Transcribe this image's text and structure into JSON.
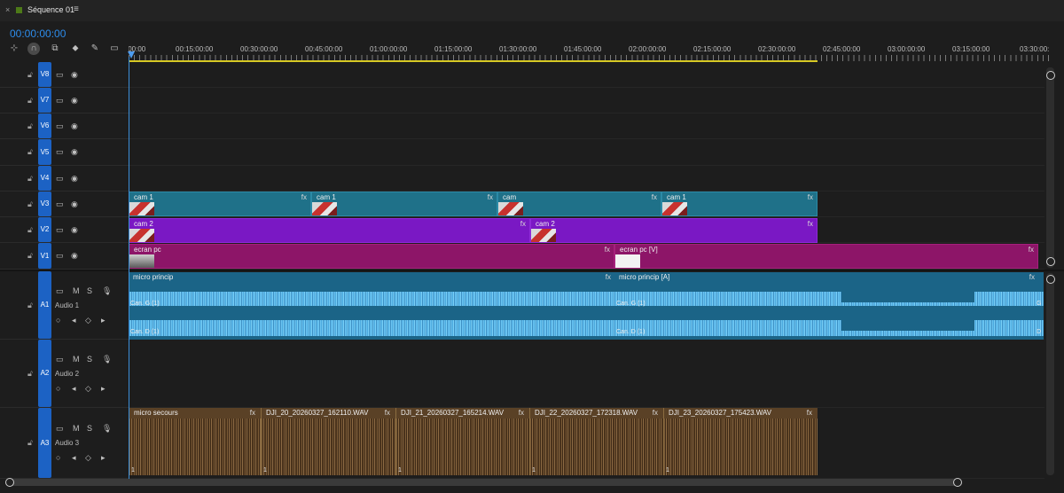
{
  "tab": {
    "close": "×",
    "title": "Séquence 01",
    "menu": "≡"
  },
  "timecode": "00:00:00:00",
  "tools": [
    "insert-snap-icon",
    "magnet-icon",
    "linked-selection-icon",
    "marker-icon",
    "wrench-icon",
    "captions-icon"
  ],
  "ruler": [
    ":00:00",
    "00:15:00:00",
    "00:30:00:00",
    "00:45:00:00",
    "01:00:00:00",
    "01:15:00:00",
    "01:30:00:00",
    "01:45:00:00",
    "02:00:00:00",
    "02:15:00:00",
    "02:30:00:00",
    "02:45:00:00",
    "03:00:00:00",
    "03:15:00:00",
    "03:30:00:"
  ],
  "video_tracks": [
    "V8",
    "V7",
    "V6",
    "V5",
    "V4",
    "V3",
    "V2",
    "V1"
  ],
  "audio_tracks": [
    {
      "id": "A1",
      "name": "Audio 1",
      "m": "M",
      "s": "S"
    },
    {
      "id": "A2",
      "name": "Audio 2",
      "m": "M",
      "s": "S"
    },
    {
      "id": "A3",
      "name": "Audio 3",
      "m": "M",
      "s": "S"
    }
  ],
  "clips": {
    "v3": [
      "cam 1",
      "cam 1",
      "cam",
      "cam 1"
    ],
    "v2": [
      "cam 2",
      "cam 2"
    ],
    "v1": [
      "ecran pc",
      "ecran pc [V]"
    ],
    "a1": [
      "micro princip",
      "micro princip [A]"
    ],
    "a3": [
      "micro secours",
      "DJI_20_20260327_162110.WAV",
      "DJI_21_20260327_165214.WAV",
      "DJI_22_20260327_172318.WAV",
      "DJI_23_20260327_175423.WAV"
    ]
  },
  "fx": "fx",
  "channels": {
    "left": "Can. G (1)",
    "right": "Can. D (1)",
    "left_short": "G",
    "right_short": "D"
  },
  "clip_number": "1",
  "colors": {
    "accent": "#2d8ceb",
    "video_v3": "#1f7189",
    "video_v2": "#7a18c4",
    "video_v1": "#8d1568",
    "audio_a1": "#1b6487",
    "audio_a3": "#5a4126",
    "work_area": "#d6c824"
  }
}
